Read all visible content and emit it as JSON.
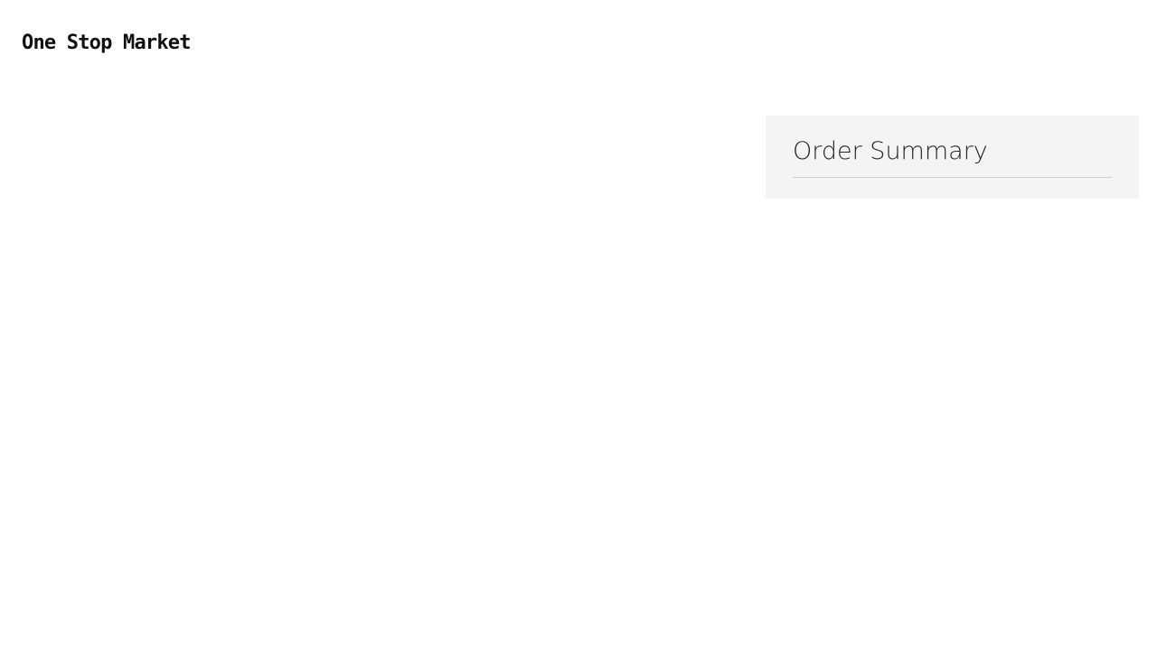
{
  "header": {
    "logo": {
      "text": "One Stop Market"
    }
  },
  "order_summary": {
    "title": "Order Summary"
  }
}
